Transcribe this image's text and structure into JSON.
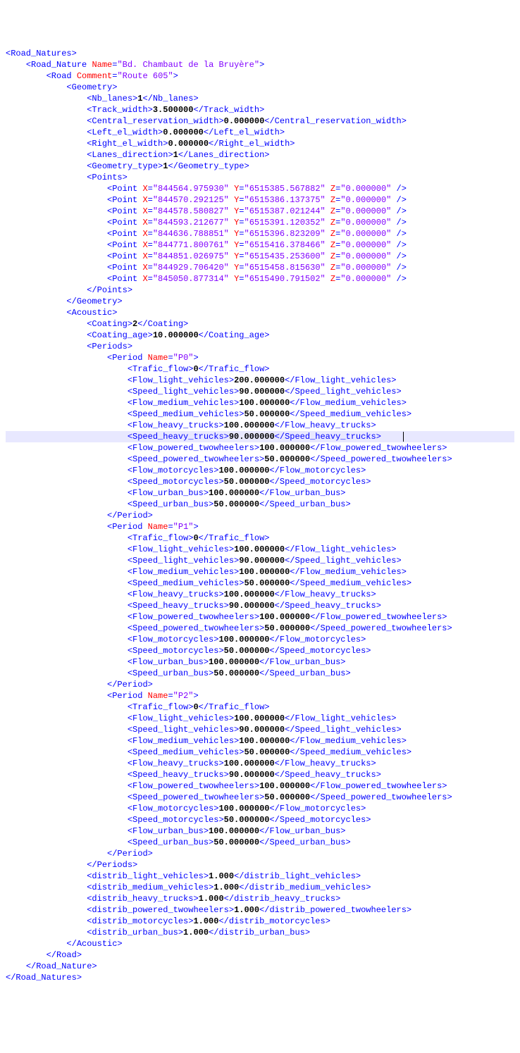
{
  "indent": "    ",
  "highlighted_line_index": 32,
  "lines": [
    {
      "d": 0,
      "t": "open",
      "tag": "Road_Natures"
    },
    {
      "d": 1,
      "t": "open",
      "tag": "Road_Nature",
      "attrs": [
        [
          "Name",
          "Bd. Chambaut de la Bruyère"
        ]
      ]
    },
    {
      "d": 2,
      "t": "open",
      "tag": "Road",
      "attrs": [
        [
          "Comment",
          "Route 605"
        ]
      ]
    },
    {
      "d": 3,
      "t": "open",
      "tag": "Geometry"
    },
    {
      "d": 4,
      "t": "leaf",
      "tag": "Nb_lanes",
      "val": "1"
    },
    {
      "d": 4,
      "t": "leaf",
      "tag": "Track_width",
      "val": "3.500000"
    },
    {
      "d": 4,
      "t": "leaf",
      "tag": "Central_reservation_width",
      "val": "0.000000"
    },
    {
      "d": 4,
      "t": "leaf",
      "tag": "Left_el_width",
      "val": "0.000000"
    },
    {
      "d": 4,
      "t": "leaf",
      "tag": "Right_el_width",
      "val": "0.000000"
    },
    {
      "d": 4,
      "t": "leaf",
      "tag": "Lanes_direction",
      "val": "1"
    },
    {
      "d": 4,
      "t": "leaf",
      "tag": "Geometry_type",
      "val": "1"
    },
    {
      "d": 4,
      "t": "open",
      "tag": "Points"
    },
    {
      "d": 5,
      "t": "self",
      "tag": "Point",
      "attrs": [
        [
          "X",
          "844564.975930"
        ],
        [
          "Y",
          "6515385.567882"
        ],
        [
          "Z",
          "0.000000"
        ]
      ]
    },
    {
      "d": 5,
      "t": "self",
      "tag": "Point",
      "attrs": [
        [
          "X",
          "844570.292125"
        ],
        [
          "Y",
          "6515386.137375"
        ],
        [
          "Z",
          "0.000000"
        ]
      ]
    },
    {
      "d": 5,
      "t": "self",
      "tag": "Point",
      "attrs": [
        [
          "X",
          "844578.580827"
        ],
        [
          "Y",
          "6515387.021244"
        ],
        [
          "Z",
          "0.000000"
        ]
      ]
    },
    {
      "d": 5,
      "t": "self",
      "tag": "Point",
      "attrs": [
        [
          "X",
          "844593.212677"
        ],
        [
          "Y",
          "6515391.120352"
        ],
        [
          "Z",
          "0.000000"
        ]
      ]
    },
    {
      "d": 5,
      "t": "self",
      "tag": "Point",
      "attrs": [
        [
          "X",
          "844636.788851"
        ],
        [
          "Y",
          "6515396.823209"
        ],
        [
          "Z",
          "0.000000"
        ]
      ]
    },
    {
      "d": 5,
      "t": "self",
      "tag": "Point",
      "attrs": [
        [
          "X",
          "844771.800761"
        ],
        [
          "Y",
          "6515416.378466"
        ],
        [
          "Z",
          "0.000000"
        ]
      ]
    },
    {
      "d": 5,
      "t": "self",
      "tag": "Point",
      "attrs": [
        [
          "X",
          "844851.026975"
        ],
        [
          "Y",
          "6515435.253600"
        ],
        [
          "Z",
          "0.000000"
        ]
      ]
    },
    {
      "d": 5,
      "t": "self",
      "tag": "Point",
      "attrs": [
        [
          "X",
          "844929.706420"
        ],
        [
          "Y",
          "6515458.815630"
        ],
        [
          "Z",
          "0.000000"
        ]
      ]
    },
    {
      "d": 5,
      "t": "self",
      "tag": "Point",
      "attrs": [
        [
          "X",
          "845050.877314"
        ],
        [
          "Y",
          "6515490.791502"
        ],
        [
          "Z",
          "0.000000"
        ]
      ]
    },
    {
      "d": 4,
      "t": "close",
      "tag": "Points"
    },
    {
      "d": 3,
      "t": "close",
      "tag": "Geometry"
    },
    {
      "d": 3,
      "t": "open",
      "tag": "Acoustic"
    },
    {
      "d": 4,
      "t": "leaf",
      "tag": "Coating",
      "val": "2"
    },
    {
      "d": 4,
      "t": "leaf",
      "tag": "Coating_age",
      "val": "10.000000"
    },
    {
      "d": 4,
      "t": "open",
      "tag": "Periods"
    },
    {
      "d": 5,
      "t": "open",
      "tag": "Period",
      "attrs": [
        [
          "Name",
          "P0"
        ]
      ]
    },
    {
      "d": 6,
      "t": "leaf",
      "tag": "Trafic_flow",
      "val": "0"
    },
    {
      "d": 6,
      "t": "leaf",
      "tag": "Flow_light_vehicles",
      "val": "200.000000"
    },
    {
      "d": 6,
      "t": "leaf",
      "tag": "Speed_light_vehicles",
      "val": "90.000000"
    },
    {
      "d": 6,
      "t": "leaf",
      "tag": "Flow_medium_vehicles",
      "val": "100.000000"
    },
    {
      "d": 6,
      "t": "leaf",
      "tag": "Speed_medium_vehicles",
      "val": "50.000000"
    },
    {
      "d": 6,
      "t": "leaf",
      "tag": "Flow_heavy_trucks",
      "val": "100.000000"
    },
    {
      "d": 6,
      "t": "leaf",
      "tag": "Speed_heavy_trucks",
      "val": "90.000000"
    },
    {
      "d": 6,
      "t": "leaf",
      "tag": "Flow_powered_twowheelers",
      "val": "100.000000"
    },
    {
      "d": 6,
      "t": "leaf",
      "tag": "Speed_powered_twowheelers",
      "val": "50.000000"
    },
    {
      "d": 6,
      "t": "leaf",
      "tag": "Flow_motorcycles",
      "val": "100.000000"
    },
    {
      "d": 6,
      "t": "leaf",
      "tag": "Speed_motorcycles",
      "val": "50.000000"
    },
    {
      "d": 6,
      "t": "leaf",
      "tag": "Flow_urban_bus",
      "val": "100.000000"
    },
    {
      "d": 6,
      "t": "leaf",
      "tag": "Speed_urban_bus",
      "val": "50.000000"
    },
    {
      "d": 5,
      "t": "close",
      "tag": "Period"
    },
    {
      "d": 5,
      "t": "open",
      "tag": "Period",
      "attrs": [
        [
          "Name",
          "P1"
        ]
      ]
    },
    {
      "d": 6,
      "t": "leaf",
      "tag": "Trafic_flow",
      "val": "0"
    },
    {
      "d": 6,
      "t": "leaf",
      "tag": "Flow_light_vehicles",
      "val": "100.000000"
    },
    {
      "d": 6,
      "t": "leaf",
      "tag": "Speed_light_vehicles",
      "val": "90.000000"
    },
    {
      "d": 6,
      "t": "leaf",
      "tag": "Flow_medium_vehicles",
      "val": "100.000000"
    },
    {
      "d": 6,
      "t": "leaf",
      "tag": "Speed_medium_vehicles",
      "val": "50.000000"
    },
    {
      "d": 6,
      "t": "leaf",
      "tag": "Flow_heavy_trucks",
      "val": "100.000000"
    },
    {
      "d": 6,
      "t": "leaf",
      "tag": "Speed_heavy_trucks",
      "val": "90.000000"
    },
    {
      "d": 6,
      "t": "leaf",
      "tag": "Flow_powered_twowheelers",
      "val": "100.000000"
    },
    {
      "d": 6,
      "t": "leaf",
      "tag": "Speed_powered_twowheelers",
      "val": "50.000000"
    },
    {
      "d": 6,
      "t": "leaf",
      "tag": "Flow_motorcycles",
      "val": "100.000000"
    },
    {
      "d": 6,
      "t": "leaf",
      "tag": "Speed_motorcycles",
      "val": "50.000000"
    },
    {
      "d": 6,
      "t": "leaf",
      "tag": "Flow_urban_bus",
      "val": "100.000000"
    },
    {
      "d": 6,
      "t": "leaf",
      "tag": "Speed_urban_bus",
      "val": "50.000000"
    },
    {
      "d": 5,
      "t": "close",
      "tag": "Period"
    },
    {
      "d": 5,
      "t": "open",
      "tag": "Period",
      "attrs": [
        [
          "Name",
          "P2"
        ]
      ]
    },
    {
      "d": 6,
      "t": "leaf",
      "tag": "Trafic_flow",
      "val": "0"
    },
    {
      "d": 6,
      "t": "leaf",
      "tag": "Flow_light_vehicles",
      "val": "100.000000"
    },
    {
      "d": 6,
      "t": "leaf",
      "tag": "Speed_light_vehicles",
      "val": "90.000000"
    },
    {
      "d": 6,
      "t": "leaf",
      "tag": "Flow_medium_vehicles",
      "val": "100.000000"
    },
    {
      "d": 6,
      "t": "leaf",
      "tag": "Speed_medium_vehicles",
      "val": "50.000000"
    },
    {
      "d": 6,
      "t": "leaf",
      "tag": "Flow_heavy_trucks",
      "val": "100.000000"
    },
    {
      "d": 6,
      "t": "leaf",
      "tag": "Speed_heavy_trucks",
      "val": "90.000000"
    },
    {
      "d": 6,
      "t": "leaf",
      "tag": "Flow_powered_twowheelers",
      "val": "100.000000"
    },
    {
      "d": 6,
      "t": "leaf",
      "tag": "Speed_powered_twowheelers",
      "val": "50.000000"
    },
    {
      "d": 6,
      "t": "leaf",
      "tag": "Flow_motorcycles",
      "val": "100.000000"
    },
    {
      "d": 6,
      "t": "leaf",
      "tag": "Speed_motorcycles",
      "val": "50.000000"
    },
    {
      "d": 6,
      "t": "leaf",
      "tag": "Flow_urban_bus",
      "val": "100.000000"
    },
    {
      "d": 6,
      "t": "leaf",
      "tag": "Speed_urban_bus",
      "val": "50.000000"
    },
    {
      "d": 5,
      "t": "close",
      "tag": "Period"
    },
    {
      "d": 4,
      "t": "close",
      "tag": "Periods"
    },
    {
      "d": 4,
      "t": "leaf",
      "tag": "distrib_light_vehicles",
      "val": "1.000"
    },
    {
      "d": 4,
      "t": "leaf",
      "tag": "distrib_medium_vehicles",
      "val": "1.000"
    },
    {
      "d": 4,
      "t": "leaf",
      "tag": "distrib_heavy_trucks",
      "val": "1.000"
    },
    {
      "d": 4,
      "t": "leaf",
      "tag": "distrib_powered_twowheelers",
      "val": "1.000"
    },
    {
      "d": 4,
      "t": "leaf",
      "tag": "distrib_motorcycles",
      "val": "1.000"
    },
    {
      "d": 4,
      "t": "leaf",
      "tag": "distrib_urban_bus",
      "val": "1.000"
    },
    {
      "d": 3,
      "t": "close",
      "tag": "Acoustic"
    },
    {
      "d": 2,
      "t": "close",
      "tag": "Road"
    },
    {
      "d": 1,
      "t": "close",
      "tag": "Road_Nature"
    },
    {
      "d": 0,
      "t": "close",
      "tag": "Road_Natures"
    }
  ]
}
